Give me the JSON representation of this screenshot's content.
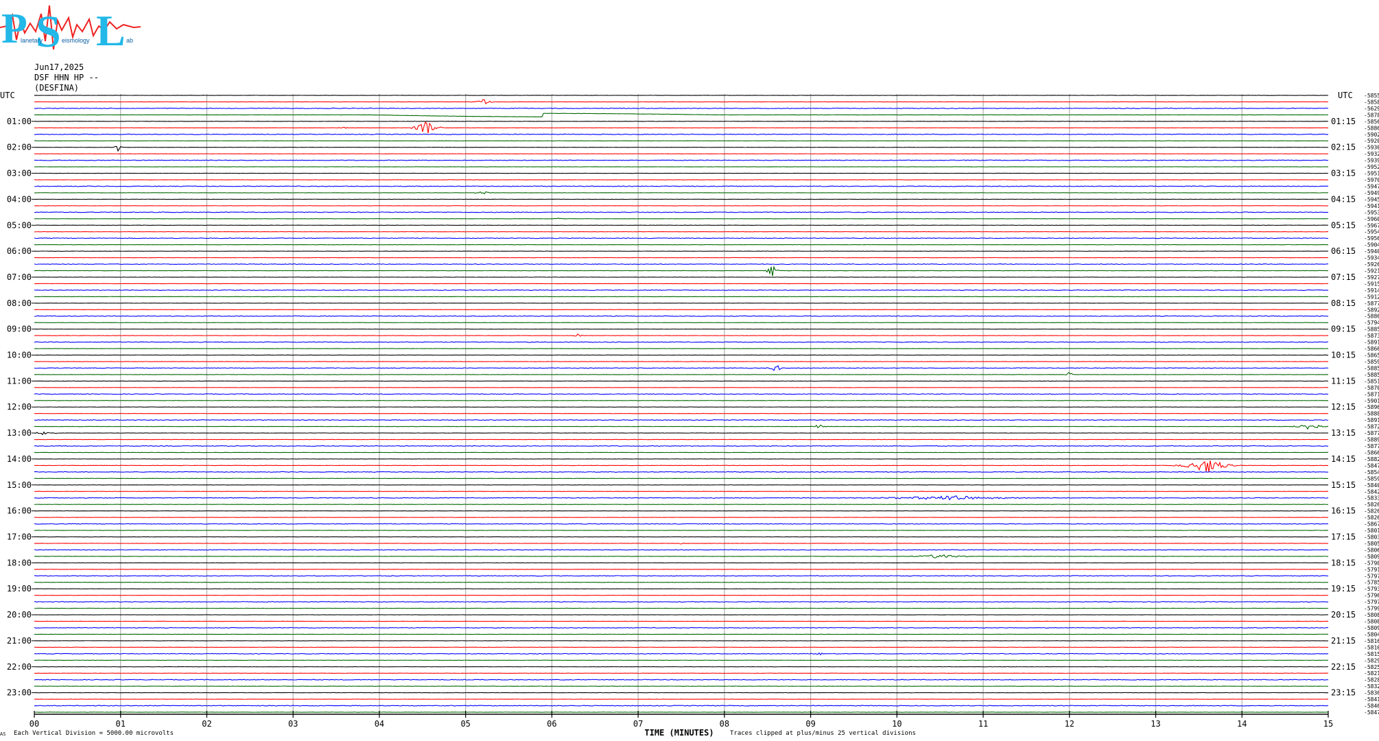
{
  "logo": {
    "big_letters": [
      "P",
      "S",
      "L"
    ],
    "small_words": [
      "lanetary",
      "eismology",
      "ab"
    ],
    "colors": {
      "letters": "#22b8e8",
      "wave": "#ee2222",
      "words": "#0b5fa5"
    }
  },
  "header": {
    "date": "Jun17,2025",
    "station": "DSF HHN HP --",
    "site": "(DESFINA)"
  },
  "chart_data": {
    "type": "line",
    "description_kind": "helicorder",
    "left_axis_title": "UTC",
    "right_axis_title": "UTC",
    "left_labels": [
      "01:00",
      "02:00",
      "03:00",
      "04:00",
      "05:00",
      "06:00",
      "07:00",
      "08:00",
      "09:00",
      "10:00",
      "11:00",
      "12:00",
      "13:00",
      "14:00",
      "15:00",
      "16:00",
      "17:00",
      "18:00",
      "19:00",
      "20:00",
      "21:00",
      "22:00",
      "23:00"
    ],
    "right_labels": [
      "01:15",
      "02:15",
      "03:15",
      "04:15",
      "05:15",
      "06:15",
      "07:15",
      "08:15",
      "09:15",
      "10:15",
      "11:15",
      "12:15",
      "13:15",
      "14:15",
      "15:15",
      "16:15",
      "17:15",
      "18:15",
      "19:15",
      "20:15",
      "21:15",
      "22:15",
      "23:15"
    ],
    "x_ticks": [
      "00",
      "01",
      "02",
      "03",
      "04",
      "05",
      "06",
      "07",
      "08",
      "09",
      "10",
      "11",
      "12",
      "13",
      "14",
      "15"
    ],
    "xlim": [
      0,
      15
    ],
    "xlabel": "TIME (MINUTES)",
    "trace_count": 96,
    "trace_colors": [
      "#000000",
      "#ff0000",
      "#0000ff",
      "#006600"
    ],
    "grid_color": "#b0b0b0",
    "offset_values": [
      "-5855",
      "-5858",
      "-5629",
      "-5878",
      "-5856",
      "-5886",
      "-5902",
      "-5920",
      "-5930",
      "-5932",
      "-5939",
      "-5952",
      "-5951",
      "-5970",
      "-5947",
      "-5949",
      "-5945",
      "-5941",
      "-5953",
      "-5960",
      "-5967",
      "-5954",
      "-5956",
      "-5904",
      "-5940",
      "-5934",
      "-5926",
      "-5921",
      "-5927",
      "-5915",
      "-5914",
      "-5912",
      "-5877",
      "-5892",
      "-5886",
      "-5794",
      "-5885",
      "-5873",
      "-5891",
      "-5866",
      "-5865",
      "-5859",
      "-5885",
      "-5885",
      "-5851",
      "-5870",
      "-5871",
      "-5901",
      "-5896",
      "-5888",
      "-5891",
      "-5872",
      "-5877",
      "-5889",
      "-5877",
      "-5866",
      "-5882",
      "-5847",
      "-5854",
      "-5859",
      "-5840",
      "-5842",
      "-5833",
      "-5826",
      "-5826",
      "-5826",
      "-5867",
      "-5801",
      "-5803",
      "-5805",
      "-5806",
      "-5809",
      "-5798",
      "-5791",
      "-5797",
      "-5785",
      "-5793",
      "-5796",
      "-5797",
      "-5799",
      "-5808",
      "-5808",
      "-5809",
      "-5804",
      "-5816",
      "-5810",
      "-5815",
      "-5829",
      "-5825",
      "-5821",
      "-5828",
      "-5832",
      "-5836",
      "-5841",
      "-5846",
      "-5847"
    ],
    "events": [
      {
        "trace": 1,
        "minute": 5.2,
        "amp": 0.35,
        "width": 0.15
      },
      {
        "trace": 3,
        "minute": 5.9,
        "amp": 0.0,
        "width": 2.0,
        "kind": "drift"
      },
      {
        "trace": 5,
        "minute": 3.6,
        "amp": 0.2,
        "width": 0.1
      },
      {
        "trace": 5,
        "minute": 4.55,
        "amp": 1.0,
        "width": 0.2
      },
      {
        "trace": 8,
        "minute": 0.97,
        "amp": 0.6,
        "width": 0.05
      },
      {
        "trace": 15,
        "minute": 5.2,
        "amp": 0.25,
        "width": 0.15
      },
      {
        "trace": 19,
        "minute": 6.05,
        "amp": 0.2,
        "width": 0.1
      },
      {
        "trace": 27,
        "minute": 8.55,
        "amp": 1.0,
        "width": 0.08
      },
      {
        "trace": 37,
        "minute": 6.3,
        "amp": 0.2,
        "width": 0.1
      },
      {
        "trace": 42,
        "minute": 8.6,
        "amp": 0.45,
        "width": 0.12
      },
      {
        "trace": 43,
        "minute": 12.0,
        "amp": 0.5,
        "width": 0.05
      },
      {
        "trace": 51,
        "minute": 9.1,
        "amp": 0.35,
        "width": 0.1
      },
      {
        "trace": 51,
        "minute": 14.8,
        "amp": 0.5,
        "width": 0.25
      },
      {
        "trace": 52,
        "minute": 0.1,
        "amp": 0.2,
        "width": 0.2
      },
      {
        "trace": 57,
        "minute": 13.6,
        "amp": 0.9,
        "width": 0.4
      },
      {
        "trace": 62,
        "minute": 10.6,
        "amp": 0.25,
        "width": 1.2
      },
      {
        "trace": 69,
        "minute": 7.5,
        "amp": 0.15,
        "width": 0.05
      },
      {
        "trace": 71,
        "minute": 10.5,
        "amp": 0.25,
        "width": 0.5
      },
      {
        "trace": 82,
        "minute": 10.6,
        "amp": 0.15,
        "width": 0.1
      },
      {
        "trace": 86,
        "minute": 9.1,
        "amp": 0.15,
        "width": 0.1
      }
    ]
  },
  "footer": {
    "left_mark": "AS",
    "scale_note": "Each Vertical Division = 5000.00 microvolts",
    "clip_note": "Traces clipped at plus/minus 25 vertical divisions"
  }
}
